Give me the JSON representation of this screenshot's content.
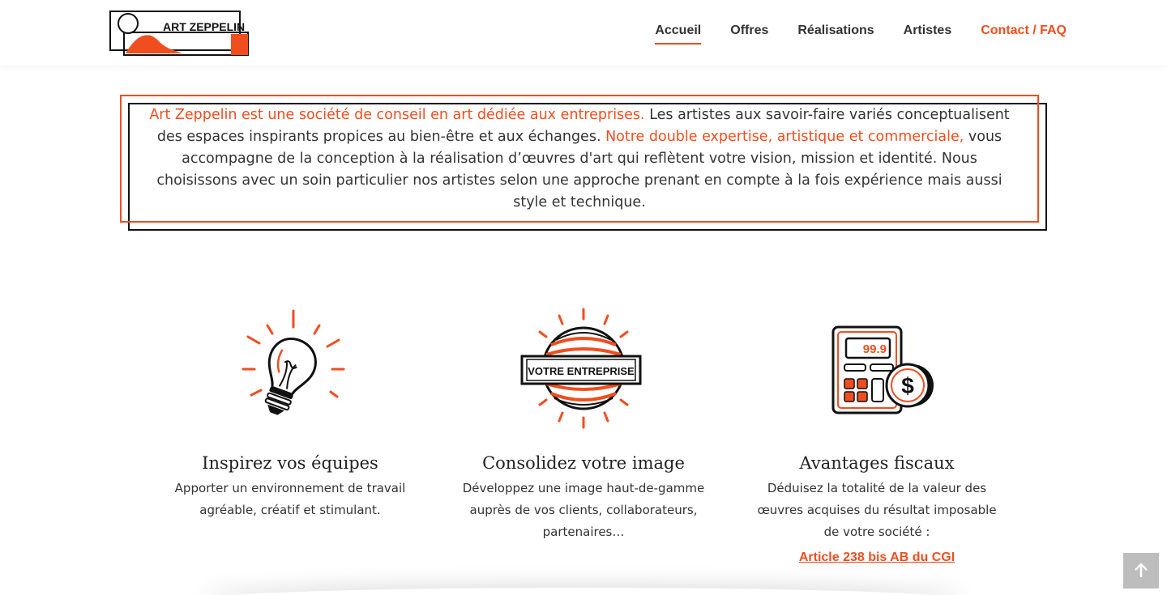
{
  "brand": {
    "name": "ART ZEPPELIN",
    "accent": "#f04e1f",
    "dark": "#111111"
  },
  "nav": {
    "items": [
      {
        "label": "Accueil",
        "active": true
      },
      {
        "label": "Offres"
      },
      {
        "label": "Réalisations"
      },
      {
        "label": "Artistes"
      },
      {
        "label": "Contact / FAQ",
        "highlight": true
      }
    ]
  },
  "intro": {
    "part1": "Art Zeppelin est une société de conseil en art dédiée aux entreprises.",
    "part2": "  Les artistes aux savoir-faire variés conceptualisent des espaces inspirants propices au bien-être et aux échanges. ",
    "part3": "Notre double expertise, artistique et commerciale,",
    "part4": " vous accompagne de la conception à la réalisation d’œuvres d'art qui reflètent votre vision, mission et identité. Nous choisissons avec un soin particulier nos artistes selon une approche prenant en compte à la fois expérience mais aussi style et technique."
  },
  "features": [
    {
      "icon": "lightbulb-icon",
      "title": "Inspirez vos équipes",
      "text_lines": [
        "Apporter un environnement de travail",
        "agréable, créatif et stimulant."
      ]
    },
    {
      "icon": "globe-badge-icon",
      "badge": "VOTRE ENTREPRISE",
      "title": "Consolidez votre image",
      "text_lines": [
        "Développez une image haut-de-gamme",
        "auprès de vos clients, collaborateurs,",
        "partenaires…"
      ]
    },
    {
      "icon": "calculator-icon",
      "display": "99.9",
      "title": "Avantages fiscaux",
      "text_lines": [
        "Déduisez la totalité de la valeur des",
        "œuvres acquises du résultat imposable",
        "de votre société :"
      ],
      "link": "Article 238 bis AB du CGI"
    }
  ],
  "scroll_top": {
    "icon": "arrow-up-icon"
  }
}
